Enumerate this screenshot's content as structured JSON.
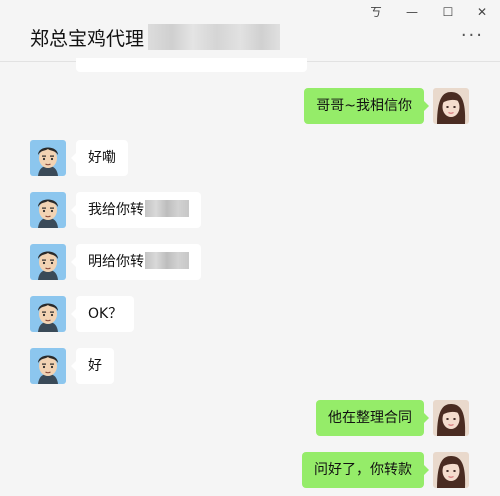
{
  "window": {
    "title": "郑总宝鸡代理",
    "controls": {
      "pin": "ㄎ",
      "minimize": "—",
      "maximize": "☐",
      "close": "✕"
    },
    "more": "···"
  },
  "colors": {
    "incoming_bubble": "#ffffff",
    "outgoing_bubble": "#95ec69",
    "background": "#f5f5f5"
  },
  "messages": [
    {
      "sender": "me",
      "text": "哥哥~我相信你"
    },
    {
      "sender": "contact",
      "text": "好嘞"
    },
    {
      "sender": "contact",
      "text": "我给你转",
      "redacted": true
    },
    {
      "sender": "contact",
      "text": "明给你转",
      "redacted": true
    },
    {
      "sender": "contact",
      "text": "OK？"
    },
    {
      "sender": "contact",
      "text": "好"
    },
    {
      "sender": "me",
      "text": "他在整理合同"
    },
    {
      "sender": "me",
      "text": "问好了，你转款"
    }
  ]
}
